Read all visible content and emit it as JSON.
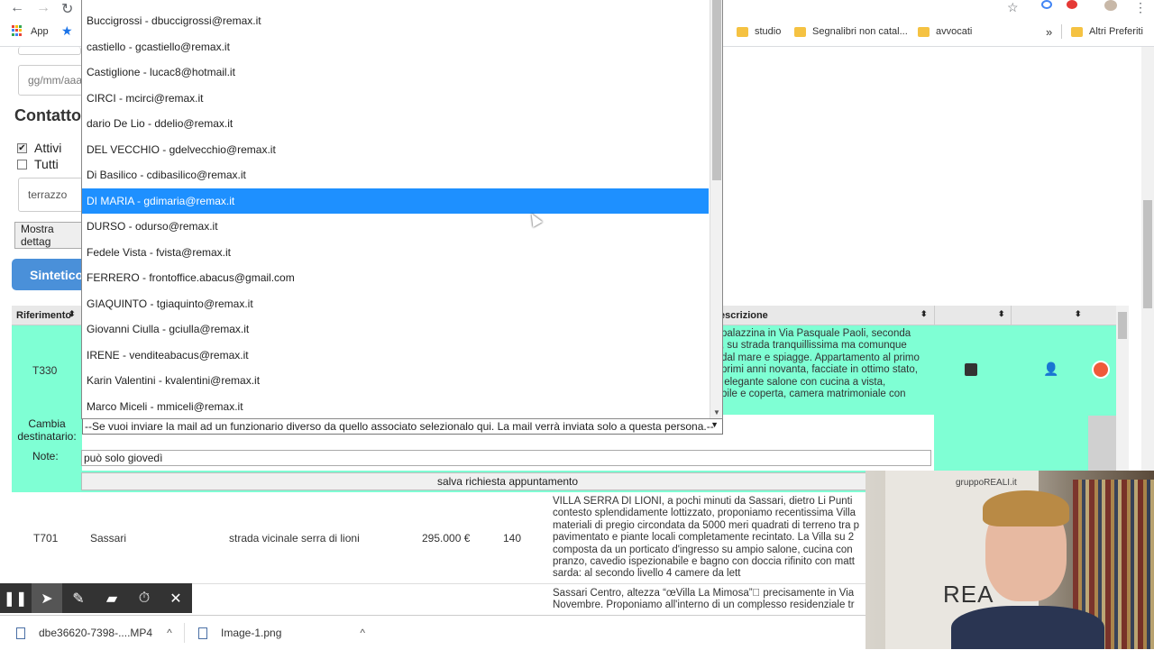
{
  "browser": {
    "apps_label": "App",
    "bookmarks": [
      "studio",
      "Segnalibri non catal...",
      "avvocati"
    ],
    "other_bookmarks": "Altri Preferiti"
  },
  "form": {
    "date_placeholder": "gg/mm/aaa",
    "contacts_title": "Contatto",
    "filter_active": "Attivi",
    "filter_all": "Tutti",
    "keyword_value": "terrazzo",
    "details_button": "Mostra dettag",
    "summary_button": "Sintetico"
  },
  "table": {
    "headers": {
      "riferimento": "Riferimento",
      "descrizione": "escrizione"
    },
    "green_row": {
      "ref": "T330",
      "description": "palazzina in Via Pasquale Paoli, seconda\n, su strada tranquillissima ma comunque\ndal mare e spiagge. Appartamento al primo\nprimi anni novanta, facciate in ottimo stato,\n elegante salone con cucina a vista,\nbile e coperta, camera matrimoniale con",
      "change_recipient_label": "Cambia\ndestinatario:",
      "notes_label": "Note:",
      "select_value": "--Se vuoi inviare la mail ad un funzionario diverso da quello associato selezionalo qui. La mail verrà inviata solo a questa persona.--",
      "notes_value": "può solo giovedì",
      "save_button": "salva richiesta appuntamento"
    },
    "row2": {
      "ref": "T701",
      "city": "Sassari",
      "address": "strada vicinale serra di lioni",
      "price": "295.000 €",
      "size": "140",
      "description": "VILLA SERRA DI LIONI, a pochi minuti da Sassari, dietro Li Punti\ncontesto splendidamente lottizzato, proponiamo recentissima Villa\nmateriali di pregio circondata da 5000 meri quadrati di terreno tra p\npavimentato e piante locali completamente recintato. La Villa su 2\ncomposta da un porticato d'ingresso su ampio salone, cucina con\npranzo, cavedio ispezionabile e bagno con doccia rifinito con matt\nsarda: al secondo livello 4 camere da lett"
    },
    "row3": {
      "description": "Sassari Centro, altezza “œVilla La Mimosa”\u0000 precisamente in Via\nNovembre. Proponiamo all'interno di un complesso residenziale tr"
    }
  },
  "dropdown": {
    "items": [
      "Buccigrossi - dbuccigrossi@remax.it",
      "castiello - gcastiello@remax.it",
      "Castiglione - lucac8@hotmail.it",
      "CIRCI - mcirci@remax.it",
      "dario De Lio - ddelio@remax.it",
      "DEL VECCHIO - gdelvecchio@remax.it",
      "Di Basilico - cdibasilico@remax.it",
      "DI MARIA - gdimaria@remax.it",
      "DURSO - odurso@remax.it",
      "Fedele Vista - fvista@remax.it",
      "FERRERO - frontoffice.abacus@gmail.com",
      "GIAQUINTO - tgiaquinto@remax.it",
      "Giovanni Ciulla - gciulla@remax.it",
      "IRENE - venditeabacus@remax.it",
      "Karin Valentini - kvalentini@remax.it",
      "Marco Miceli - mmiceli@remax.it"
    ],
    "selected_index": 7
  },
  "downloads": {
    "file1": "dbe36620-7398-....MP4",
    "file2": "Image-1.png"
  },
  "webcam": {
    "sign_text": "gruppoREALI.it",
    "sign_big": "REA"
  },
  "colors": {
    "accent": "#1e90ff",
    "row_highlight": "#7fffd4",
    "summary_button": "#4a90d9"
  }
}
